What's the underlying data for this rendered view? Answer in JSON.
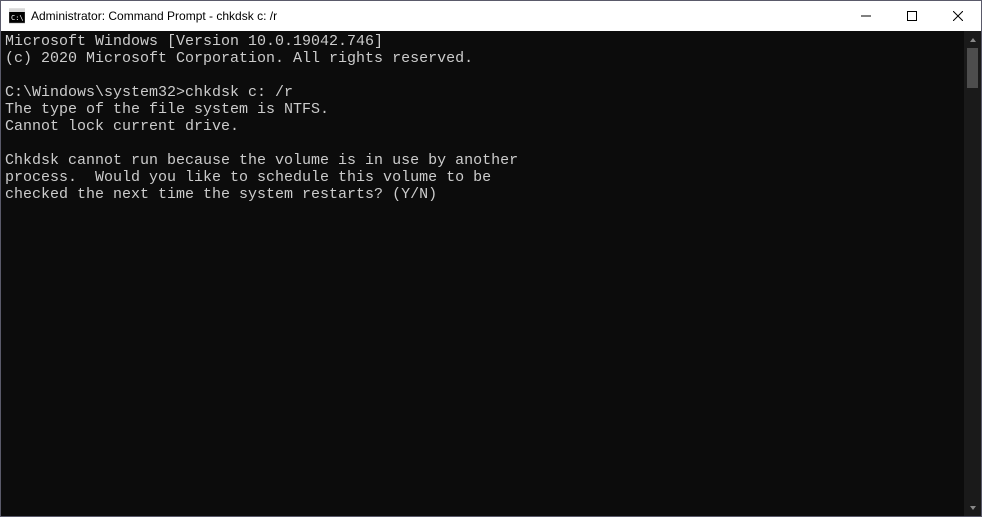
{
  "window": {
    "title": "Administrator: Command Prompt - chkdsk  c: /r"
  },
  "terminal": {
    "lines": [
      "Microsoft Windows [Version 10.0.19042.746]",
      "(c) 2020 Microsoft Corporation. All rights reserved.",
      "",
      "C:\\Windows\\system32>chkdsk c: /r",
      "The type of the file system is NTFS.",
      "Cannot lock current drive.",
      "",
      "Chkdsk cannot run because the volume is in use by another",
      "process.  Would you like to schedule this volume to be",
      "checked the next time the system restarts? (Y/N)"
    ]
  }
}
